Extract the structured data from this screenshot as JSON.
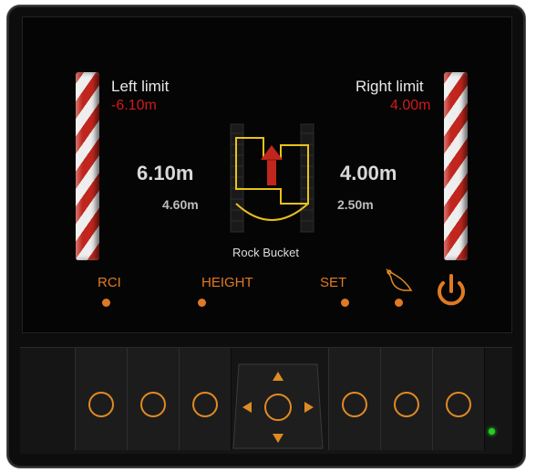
{
  "limits": {
    "left_label": "Left limit",
    "left_value": "-6.10m",
    "right_label": "Right limit",
    "right_value": "4.00m"
  },
  "readings": {
    "left_main": "6.10m",
    "left_sub": "4.60m",
    "right_main": "4.00m",
    "right_sub": "2.50m"
  },
  "tool_name": "Rock Bucket",
  "menu": {
    "rci": "RCI",
    "height": "HEIGHT",
    "set": "SET"
  },
  "icons": {
    "bucket": "bucket-icon",
    "power": "power-icon",
    "excavator": "excavator-topview-icon",
    "dpad": "dpad-icon",
    "led": "status-led-icon"
  },
  "colors": {
    "accent": "#e07a22",
    "limit_value": "#d11a1a",
    "machine_outline": "#e8c21a",
    "arrow": "#c0261d",
    "led": "#1fd11f"
  }
}
